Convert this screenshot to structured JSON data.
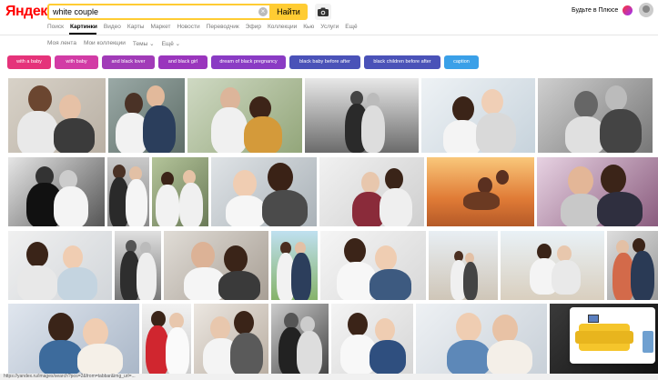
{
  "header": {
    "logo": "Яндекс",
    "search_value": "white couple",
    "search_button": "Найти",
    "clear_icon": "×",
    "plus_text": "Будьте в Плюсе"
  },
  "nav": {
    "items": [
      "Поиск",
      "Картинки",
      "Видео",
      "Карты",
      "Маркет",
      "Новости",
      "Переводчик",
      "Эфир",
      "Коллекции",
      "Кью",
      "Услуги",
      "Ещё"
    ],
    "active_index": 1
  },
  "subnav": {
    "items": [
      "Моя лента",
      "Мои коллекции",
      "Темы",
      "Ещё"
    ]
  },
  "tags": [
    {
      "label": "with a baby",
      "color": "#e5337a"
    },
    {
      "label": "with baby",
      "color": "#d23ba5"
    },
    {
      "label": "and black lover",
      "color": "#a13bb8"
    },
    {
      "label": "and black girl",
      "color": "#9a35bd"
    },
    {
      "label": "dream of black pregnancy",
      "color": "#8a3bc4"
    },
    {
      "label": "black baby before after",
      "color": "#4a52b8"
    },
    {
      "label": "black children before after",
      "color": "#4a52b8"
    },
    {
      "label": "caption",
      "color": "#3aa0e8"
    }
  ],
  "status_bar": "https://yandex.ru/images/search?pos=2&from=tabbar&img_url=..."
}
